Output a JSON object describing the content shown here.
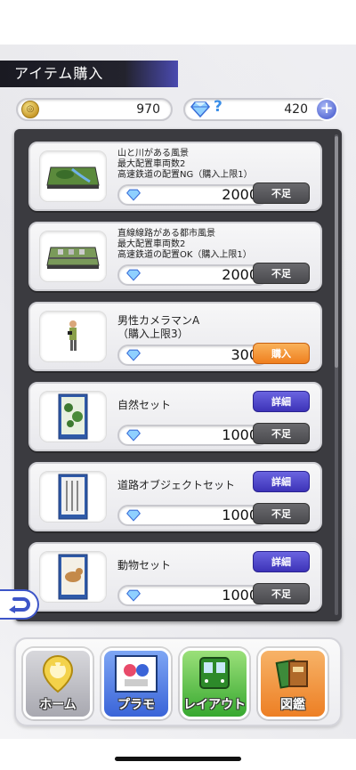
{
  "header": {
    "title": "アイテム購入"
  },
  "currency": {
    "coin_value": "970",
    "gem_label": "?",
    "gem_value": "420",
    "plus_label": "+"
  },
  "items": [
    {
      "desc": "山と川がある風景\n最大配置車両数2\n高速鉄道の配置NG（購入上限1）",
      "price": "2000",
      "buttons": [
        "不足"
      ]
    },
    {
      "desc": "直線線路がある都市風景\n最大配置車両数2\n高速鉄道の配置OK（購入上限1）",
      "price": "2000",
      "buttons": [
        "不足"
      ]
    },
    {
      "desc": "男性カメラマンA\n（購入上限3）",
      "price": "300",
      "buttons": [
        "購入"
      ]
    },
    {
      "desc": "自然セット",
      "price": "1000",
      "buttons": [
        "詳細",
        "不足"
      ]
    },
    {
      "desc": "道路オブジェクトセット",
      "price": "1000",
      "buttons": [
        "詳細",
        "不足"
      ]
    },
    {
      "desc": "動物セット",
      "price": "1000",
      "buttons": [
        "詳細",
        "不足"
      ]
    }
  ],
  "nav": {
    "home": "ホーム",
    "plamo": "プラモ",
    "layout": "レイアウト",
    "zukan": "図鑑"
  },
  "colors": {
    "short_button": "#4a4a4e",
    "buy_button": "#ef7f1f",
    "detail_button": "#3d33b8",
    "gem_blue": "#3a8ee8"
  }
}
